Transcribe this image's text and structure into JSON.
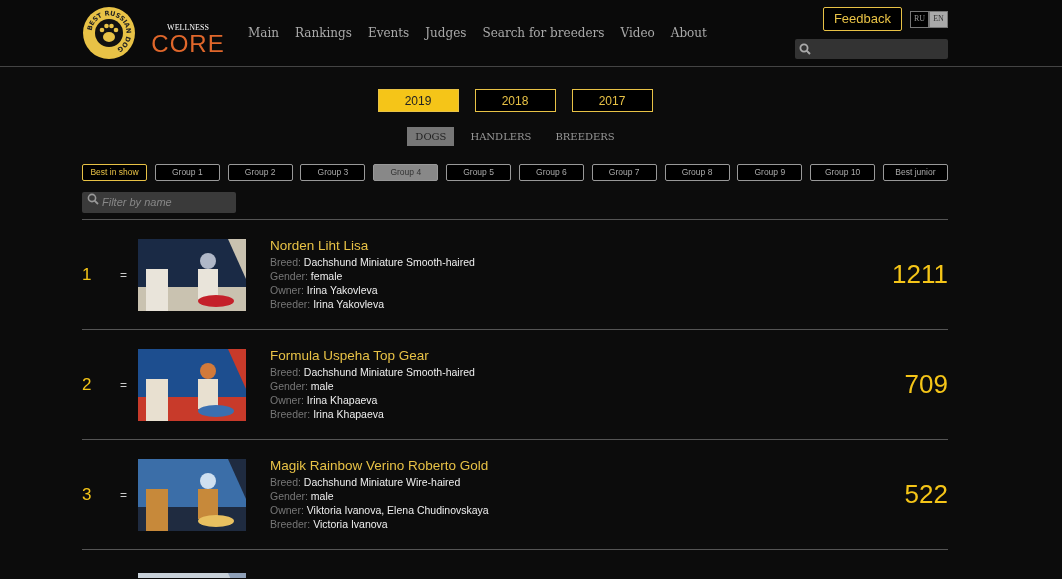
{
  "logos": {
    "badge_text": "BEST RUSSIAN DOG",
    "sponsor_top": "WELLNESS",
    "sponsor_main": "CORE"
  },
  "nav": [
    {
      "label": "Main"
    },
    {
      "label": "Rankings"
    },
    {
      "label": "Events"
    },
    {
      "label": "Judges"
    },
    {
      "label": "Search for breeders"
    },
    {
      "label": "Video"
    },
    {
      "label": "About"
    }
  ],
  "feedback": "Feedback",
  "languages": [
    {
      "label": "RU",
      "selected": false
    },
    {
      "label": "EN",
      "selected": true
    }
  ],
  "years": [
    {
      "label": "2019",
      "selected": true
    },
    {
      "label": "2018",
      "selected": false
    },
    {
      "label": "2017",
      "selected": false
    }
  ],
  "categories": [
    {
      "label": "DOGS",
      "selected": true
    },
    {
      "label": "HANDLERS",
      "selected": false
    },
    {
      "label": "BREEDERS",
      "selected": false
    }
  ],
  "groups": [
    {
      "label": "Best in show",
      "kind": "highlight",
      "selected": false
    },
    {
      "label": "Group 1",
      "kind": "group",
      "selected": false
    },
    {
      "label": "Group 2",
      "kind": "group",
      "selected": false
    },
    {
      "label": "Group 3",
      "kind": "group",
      "selected": false
    },
    {
      "label": "Group 4",
      "kind": "group",
      "selected": true
    },
    {
      "label": "Group 5",
      "kind": "group",
      "selected": false
    },
    {
      "label": "Group 6",
      "kind": "group",
      "selected": false
    },
    {
      "label": "Group 7",
      "kind": "group",
      "selected": false
    },
    {
      "label": "Group 8",
      "kind": "group",
      "selected": false
    },
    {
      "label": "Group 9",
      "kind": "group",
      "selected": false
    },
    {
      "label": "Group 10",
      "kind": "group",
      "selected": false
    },
    {
      "label": "Best junior",
      "kind": "group",
      "selected": false
    }
  ],
  "filter": {
    "placeholder": "Filter by name"
  },
  "rows": [
    {
      "rank": "1",
      "change": "=",
      "name": "Norden Liht Lisa",
      "fields": [
        {
          "label": "Breed:",
          "value": "Dachshund Miniature Smooth-haired"
        },
        {
          "label": "Gender:",
          "value": "female"
        },
        {
          "label": "Owner:",
          "value": "Irina Yakovleva"
        },
        {
          "label": "Breeder:",
          "value": "Irina Yakovleva"
        }
      ],
      "score": "1211"
    },
    {
      "rank": "2",
      "change": "=",
      "name": "Formula Uspeha Top Gear",
      "fields": [
        {
          "label": "Breed:",
          "value": "Dachshund Miniature Smooth-haired"
        },
        {
          "label": "Gender:",
          "value": "male"
        },
        {
          "label": "Owner:",
          "value": "Irina Khapaeva"
        },
        {
          "label": "Breeder:",
          "value": "Irina Khapaeva"
        }
      ],
      "score": "709"
    },
    {
      "rank": "3",
      "change": "=",
      "name": "Magik Rainbow Verino Roberto Gold",
      "fields": [
        {
          "label": "Breed:",
          "value": "Dachshund Miniature Wire-haired"
        },
        {
          "label": "Gender:",
          "value": "male"
        },
        {
          "label": "Owner:",
          "value": "Viktoria Ivanova, Elena Chudinovskaya"
        },
        {
          "label": "Breeder:",
          "value": "Victoria Ivanova"
        }
      ],
      "score": "522"
    },
    {
      "kind": "picture"
    }
  ]
}
